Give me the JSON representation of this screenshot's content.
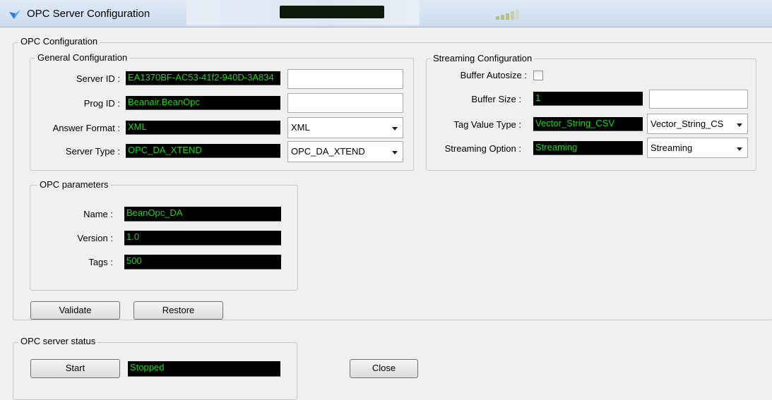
{
  "window": {
    "title": "OPC Server Configuration"
  },
  "opc_configuration": {
    "group_label": "OPC Configuration",
    "general": {
      "group_label": "General Configuration",
      "server_id": {
        "label": "Server ID :",
        "value": "EA1370BF-AC53-41f2-940D-3A834"
      },
      "prog_id": {
        "label": "Prog ID :",
        "value": "Beanair.BeanOpc"
      },
      "answer_format": {
        "label": "Answer Format :",
        "value": "XML",
        "selected": "XML"
      },
      "server_type": {
        "label": "Server Type :",
        "value": "OPC_DA_XTEND",
        "selected": "OPC_DA_XTEND"
      }
    },
    "streaming": {
      "group_label": "Streaming Configuration",
      "buffer_autosize": {
        "label": "Buffer Autosize :",
        "checked": false
      },
      "buffer_size": {
        "label": "Buffer Size :",
        "value": "1"
      },
      "tag_value_type": {
        "label": "Tag Value Type :",
        "value": "Vector_String_CSV",
        "selected": "Vector_String_CS"
      },
      "streaming_option": {
        "label": "Streaming Option :",
        "value": "Streaming",
        "selected": "Streaming"
      }
    },
    "parameters": {
      "group_label": "OPC parameters",
      "name": {
        "label": "Name :",
        "value": "BeanOpc_DA"
      },
      "version": {
        "label": "Version :",
        "value": "1.0"
      },
      "tags": {
        "label": "Tags :",
        "value": "500"
      }
    },
    "buttons": {
      "validate": "Validate",
      "restore": "Restore"
    }
  },
  "server_status": {
    "group_label": "OPC server status",
    "start_label": "Start",
    "status_value": "Stopped",
    "close_label": "Close"
  },
  "colors": {
    "readout_bg": "#000000",
    "readout_text": "#1bd41b"
  }
}
